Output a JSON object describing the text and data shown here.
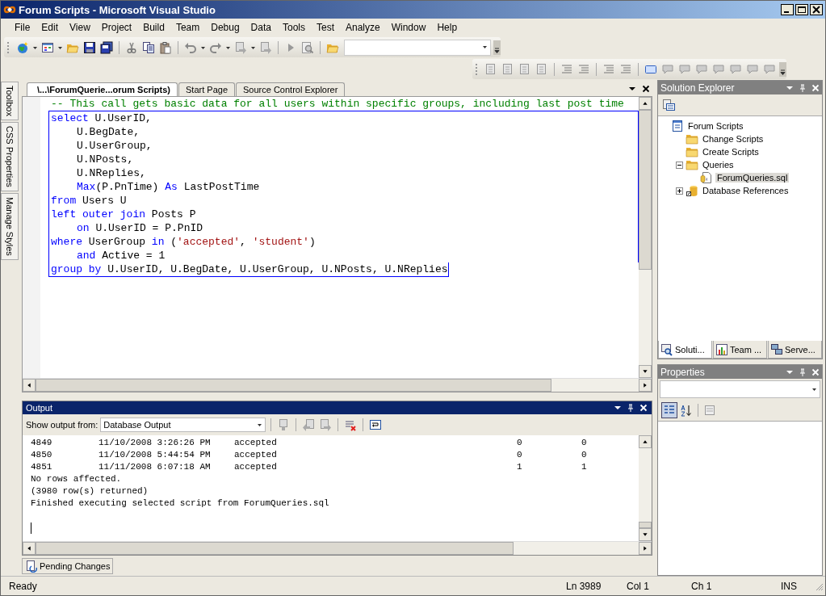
{
  "window": {
    "title": "Forum Scripts - Microsoft Visual Studio"
  },
  "menu": [
    "File",
    "Edit",
    "View",
    "Project",
    "Build",
    "Team",
    "Debug",
    "Data",
    "Tools",
    "Test",
    "Analyze",
    "Window",
    "Help"
  ],
  "left_tabs": [
    "Toolbox",
    "CSS Properties",
    "Manage Styles"
  ],
  "editor": {
    "tabs": [
      {
        "label": "\\...\\ForumQuerie...orum Scripts)",
        "selected": true
      },
      {
        "label": "Start Page",
        "selected": false
      },
      {
        "label": "Source Control Explorer",
        "selected": false
      }
    ],
    "lines": [
      {
        "indented": false,
        "selected": false,
        "tokens": [
          {
            "t": "-- This call gets basic data for all users within specific groups, including last post time",
            "kind": "comment"
          }
        ]
      },
      {
        "indented": false,
        "selected": true,
        "tokens": [
          {
            "t": "select",
            "kind": "keyword"
          },
          {
            "t": " U.UserID,",
            "kind": "plain"
          }
        ]
      },
      {
        "indented": true,
        "selected": true,
        "tokens": [
          {
            "t": "U.BegDate,",
            "kind": "plain"
          }
        ]
      },
      {
        "indented": true,
        "selected": true,
        "tokens": [
          {
            "t": "U.UserGroup,",
            "kind": "plain"
          }
        ]
      },
      {
        "indented": true,
        "selected": true,
        "tokens": [
          {
            "t": "U.NPosts,",
            "kind": "plain"
          }
        ]
      },
      {
        "indented": true,
        "selected": true,
        "tokens": [
          {
            "t": "U.NReplies,",
            "kind": "plain"
          }
        ]
      },
      {
        "indented": true,
        "selected": true,
        "tokens": [
          {
            "t": "Max",
            "kind": "function"
          },
          {
            "t": "(P.PnTime) ",
            "kind": "plain"
          },
          {
            "t": "As",
            "kind": "keyword"
          },
          {
            "t": " LastPostTime",
            "kind": "plain"
          }
        ]
      },
      {
        "indented": false,
        "selected": true,
        "tokens": [
          {
            "t": "from",
            "kind": "keyword"
          },
          {
            "t": " Users U",
            "kind": "plain"
          }
        ]
      },
      {
        "indented": false,
        "selected": true,
        "tokens": [
          {
            "t": "left outer join",
            "kind": "keyword"
          },
          {
            "t": " Posts P",
            "kind": "plain"
          }
        ]
      },
      {
        "indented": true,
        "selected": true,
        "tokens": [
          {
            "t": "on",
            "kind": "keyword"
          },
          {
            "t": " U.UserID = P.PnID",
            "kind": "plain"
          }
        ]
      },
      {
        "indented": false,
        "selected": true,
        "tokens": [
          {
            "t": "where",
            "kind": "keyword"
          },
          {
            "t": " UserGroup ",
            "kind": "plain"
          },
          {
            "t": "in",
            "kind": "keyword"
          },
          {
            "t": " (",
            "kind": "plain"
          },
          {
            "t": "'accepted'",
            "kind": "string"
          },
          {
            "t": ", ",
            "kind": "plain"
          },
          {
            "t": "'student'",
            "kind": "string"
          },
          {
            "t": ")",
            "kind": "plain"
          }
        ]
      },
      {
        "indented": true,
        "selected": true,
        "tokens": [
          {
            "t": "and",
            "kind": "keyword"
          },
          {
            "t": " Active = 1",
            "kind": "plain"
          }
        ]
      },
      {
        "indented": false,
        "selected": true,
        "tokens": [
          {
            "t": "group by",
            "kind": "keyword"
          },
          {
            "t": " U.UserID, U.BegDate, U.UserGroup, U.NPosts, U.NReplies",
            "kind": "plain"
          }
        ]
      }
    ]
  },
  "output": {
    "title": "Output",
    "show_from_label": "Show output from:",
    "source": "Database Output",
    "rows": [
      {
        "cells": [
          "4849",
          "11/10/2008 3:26:26 PM",
          "accepted",
          "0",
          "0"
        ]
      },
      {
        "cells": [
          "4850",
          "11/10/2008 5:44:54 PM",
          "accepted",
          "0",
          "0"
        ]
      },
      {
        "cells": [
          "4851",
          "11/11/2008 6:07:18 AM",
          "accepted",
          "1",
          "1"
        ]
      }
    ],
    "messages": [
      "No rows affected.",
      "(3980 row(s) returned)",
      "Finished executing selected script from ForumQueries.sql"
    ]
  },
  "bottom_tabs": [
    "Pending Changes"
  ],
  "solution_explorer": {
    "title": "Solution Explorer",
    "tree": [
      {
        "label": "Forum Scripts",
        "kind": "project",
        "selected": false,
        "children": [
          {
            "label": "Change Scripts",
            "kind": "folder",
            "selected": false
          },
          {
            "label": "Create Scripts",
            "kind": "folder",
            "selected": false
          },
          {
            "label": "Queries",
            "kind": "folder",
            "selected": false,
            "expanded": true,
            "children": [
              {
                "label": "ForumQueries.sql",
                "kind": "file",
                "selected": true
              }
            ]
          },
          {
            "label": "Database References",
            "kind": "database",
            "selected": false,
            "expanded": false
          }
        ]
      }
    ],
    "tabs": [
      {
        "label": "Soluti...",
        "selected": true
      },
      {
        "label": "Team ...",
        "selected": false
      },
      {
        "label": "Serve...",
        "selected": false
      }
    ]
  },
  "properties": {
    "title": "Properties"
  },
  "status_bar": {
    "message": "Ready",
    "line": "Ln 3989",
    "column": "Col 1",
    "char": "Ch 1",
    "mode": "INS"
  }
}
